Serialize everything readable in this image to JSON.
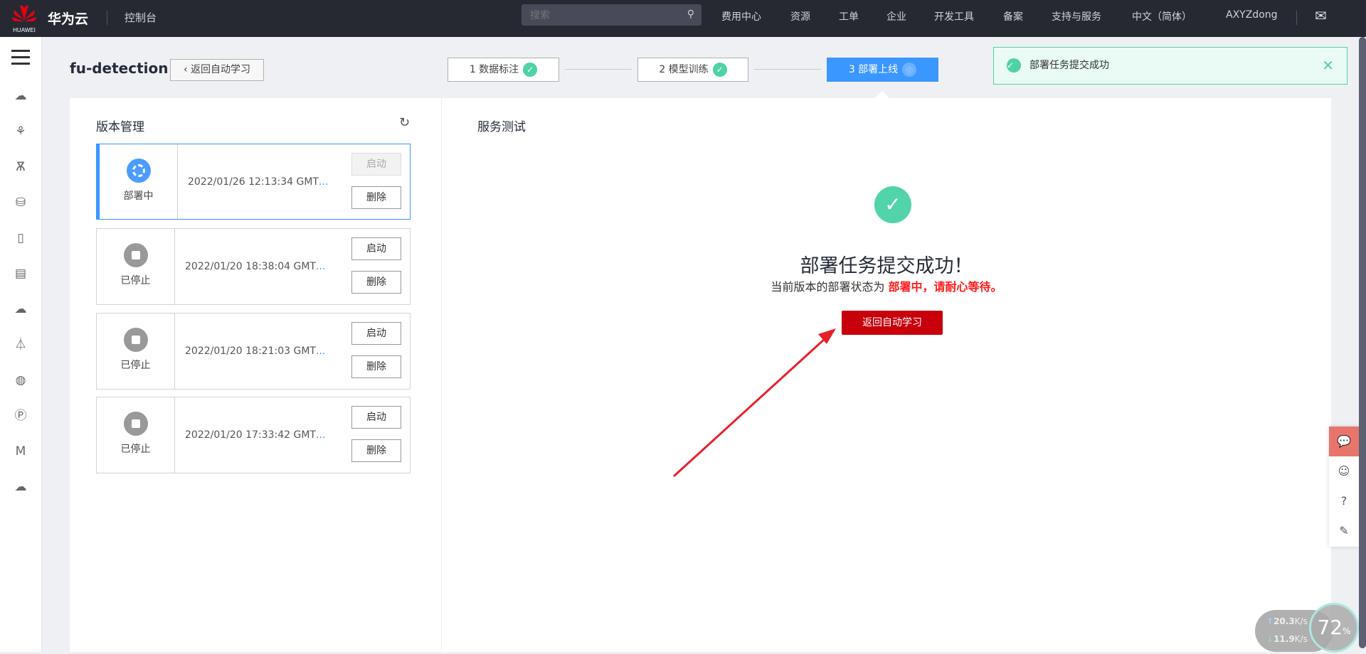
{
  "header": {
    "logo_text": "HUAWEI",
    "brand": "华为云",
    "console": "控制台",
    "search_placeholder": "搜索",
    "nav": [
      "费用中心",
      "资源",
      "工单",
      "企业",
      "开发工具",
      "备案",
      "支持与服务",
      "中文（简体）",
      "AXYZdong"
    ]
  },
  "page": {
    "title": "fu-detection",
    "back_label": "返回自动学习"
  },
  "steps": [
    {
      "label": "1 数据标注"
    },
    {
      "label": "2 模型训练"
    },
    {
      "label": "3 部署上线"
    }
  ],
  "toast": {
    "message": "部署任务提交成功",
    "close": "✕"
  },
  "versions": {
    "title": "版本管理",
    "items": [
      {
        "status": "部署中",
        "time": "2022/01/26 12:13:34 GMT",
        "start": "启动",
        "delete": "删除"
      },
      {
        "status": "已停止",
        "time": "2022/01/20 18:38:04 GMT",
        "start": "启动",
        "delete": "删除"
      },
      {
        "status": "已停止",
        "time": "2022/01/20 18:21:03 GMT",
        "start": "启动",
        "delete": "删除"
      },
      {
        "status": "已停止",
        "time": "2022/01/20 17:33:42 GMT",
        "start": "启动",
        "delete": "删除"
      }
    ]
  },
  "service": {
    "title": "服务测试",
    "heading": "部署任务提交成功！",
    "sub_prefix": "当前版本的部署状态为 ",
    "sub_highlight": "部署中，请耐心等待。",
    "button": "返回自动学习"
  },
  "widget": {
    "up": "20.3",
    "down": "11.9",
    "unit": "K/s",
    "percent": "72",
    "percent_sign": "%"
  },
  "colors": {
    "accent": "#3a97ff",
    "success": "#52d3aa",
    "danger": "#c7000b",
    "header": "#262932"
  }
}
